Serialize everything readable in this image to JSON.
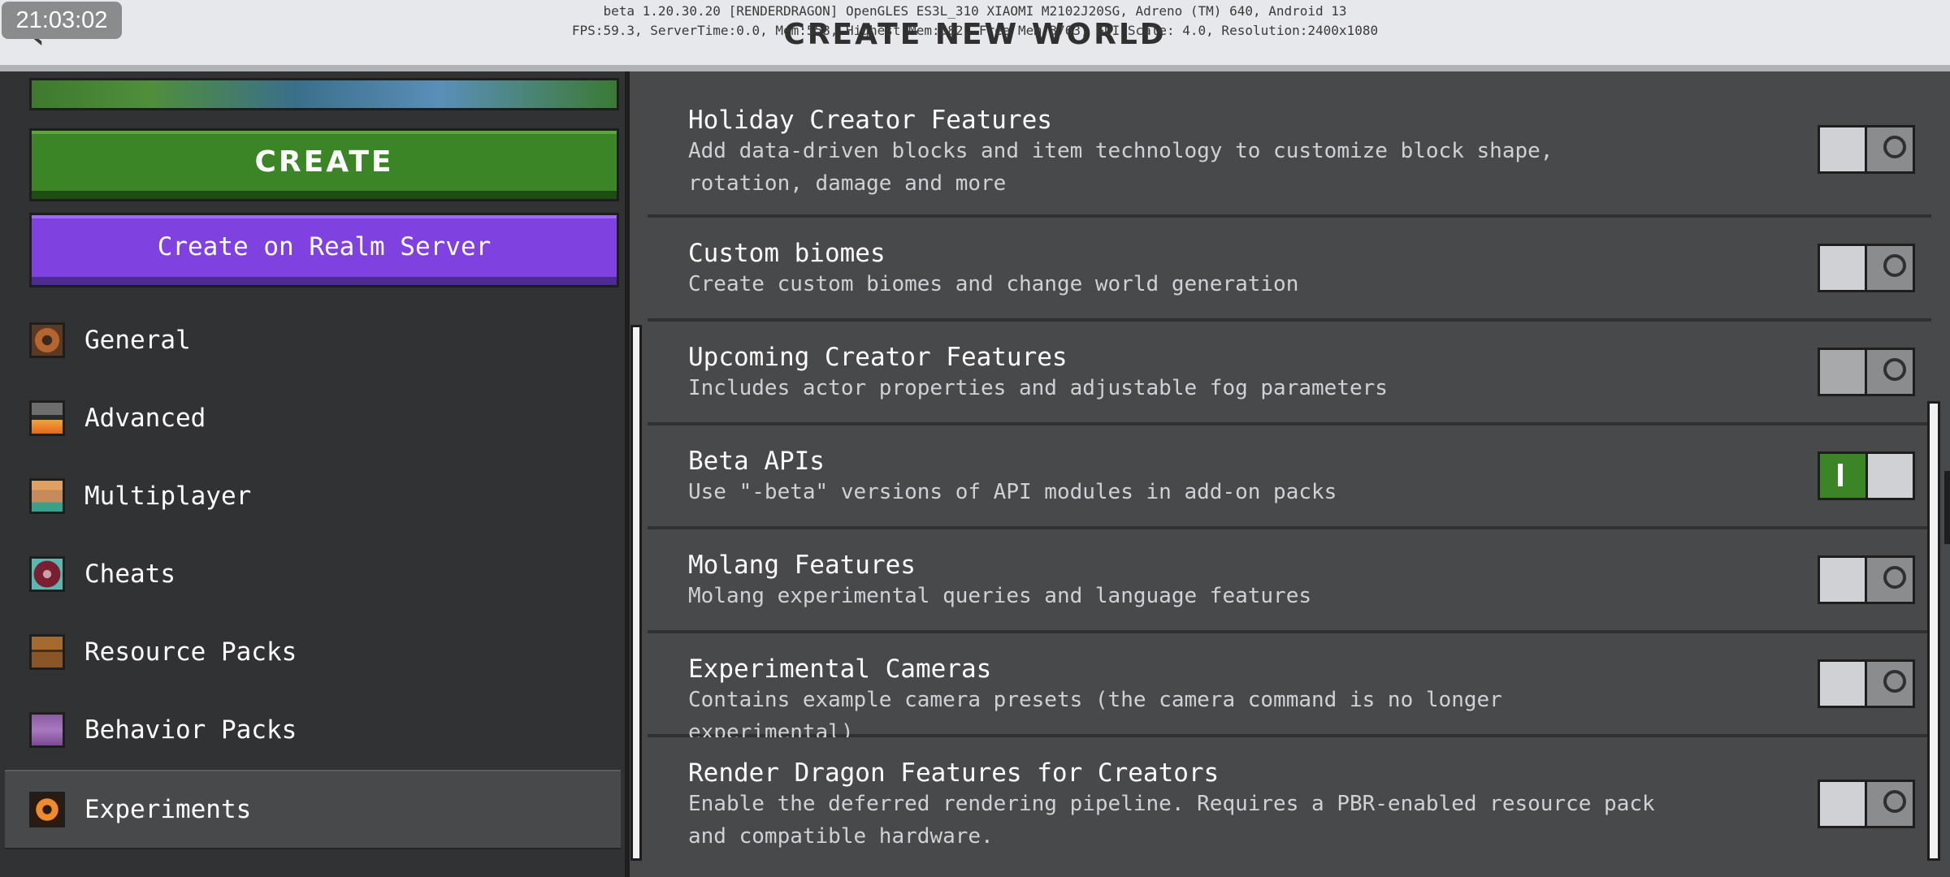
{
  "status_bar": {
    "clock": "21:03:02"
  },
  "header": {
    "title": "CREATE NEW WORLD",
    "back_icon": "back-arrow-icon",
    "debug_line_1": "beta 1.20.30.20 [RENDERDRAGON] OpenGLES ES3L_310 XIAOMI M2102J20SG, Adreno (TM) 640, Android 13",
    "debug_line_2": "FPS:59.3, ServerTime:0.0, Mem:558, Highest Mem:582, Free Mem:3763, GUI Scale: 4.0, Resolution:2400x1080"
  },
  "sidebar": {
    "create_label": "CREATE",
    "realm_label": "Create on Realm Server",
    "items": [
      {
        "label": "General",
        "icon": "gear-icon",
        "selected": false
      },
      {
        "label": "Advanced",
        "icon": "furnace-icon",
        "selected": false
      },
      {
        "label": "Multiplayer",
        "icon": "player-head-icon",
        "selected": false
      },
      {
        "label": "Cheats",
        "icon": "command-block-icon",
        "selected": false
      },
      {
        "label": "Resource Packs",
        "icon": "chest-icon",
        "selected": false
      },
      {
        "label": "Behavior Packs",
        "icon": "creeper-icon",
        "selected": false
      },
      {
        "label": "Experiments",
        "icon": "experiments-icon",
        "selected": true
      }
    ]
  },
  "experiments": [
    {
      "title": "Holiday Creator Features",
      "description": "Add data-driven blocks and item technology to customize block shape, rotation, damage and more",
      "enabled": false
    },
    {
      "title": "Custom biomes",
      "description": "Create custom biomes and change world generation",
      "enabled": false
    },
    {
      "title": "Upcoming Creator Features",
      "description": "Includes actor properties and adjustable fog parameters",
      "enabled": false
    },
    {
      "title": "Beta APIs",
      "description": "Use \"-beta\" versions of API modules in add-on packs",
      "enabled": true
    },
    {
      "title": "Molang Features",
      "description": "Molang experimental queries and language features",
      "enabled": false
    },
    {
      "title": "Experimental Cameras",
      "description": "Contains example camera presets (the camera command is no longer experimental)",
      "enabled": false
    },
    {
      "title": "Render Dragon Features for Creators",
      "description": "Enable the deferred rendering pipeline. Requires a PBR-enabled resource pack and compatible hardware.",
      "enabled": false
    }
  ],
  "colors": {
    "create_green": "#3c8527",
    "realm_purple": "#7f41e0",
    "toggle_on": "#3c8527",
    "panel_dark": "#313233",
    "panel_mid": "#48494a"
  }
}
